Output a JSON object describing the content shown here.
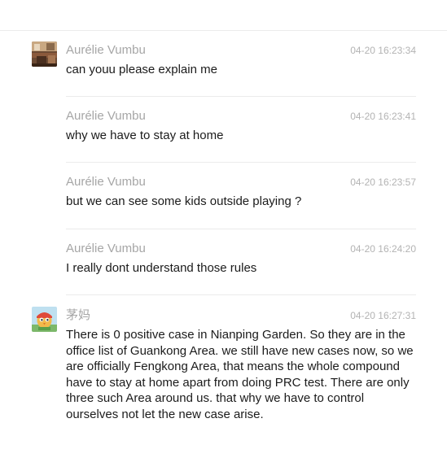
{
  "messages": [
    {
      "sender": "Aurélie Vumbu",
      "time": "04-20 16:23:34",
      "text": "can youu please explain me",
      "avatar": "room-photo"
    },
    {
      "sender": "Aurélie Vumbu",
      "time": "04-20 16:23:41",
      "text": "why we have to stay at home"
    },
    {
      "sender": "Aurélie Vumbu",
      "time": "04-20 16:23:57",
      "text": "but we can see some kids outside playing ?"
    },
    {
      "sender": "Aurélie Vumbu",
      "time": "04-20 16:24:20",
      "text": "I really dont understand those rules"
    },
    {
      "sender": "茅妈",
      "time": "04-20 16:27:31",
      "text": "There is 0 positive case in Nianping Garden. So they are in the office list of Guankong Area. we still have new cases now, so we are officially Fengkong Area, that means the whole compound have to stay at home apart from doing PRC test. There are only three such Area around us. that why we have to control ourselves not let the new case arise.",
      "avatar": "cartoon-bird"
    }
  ]
}
